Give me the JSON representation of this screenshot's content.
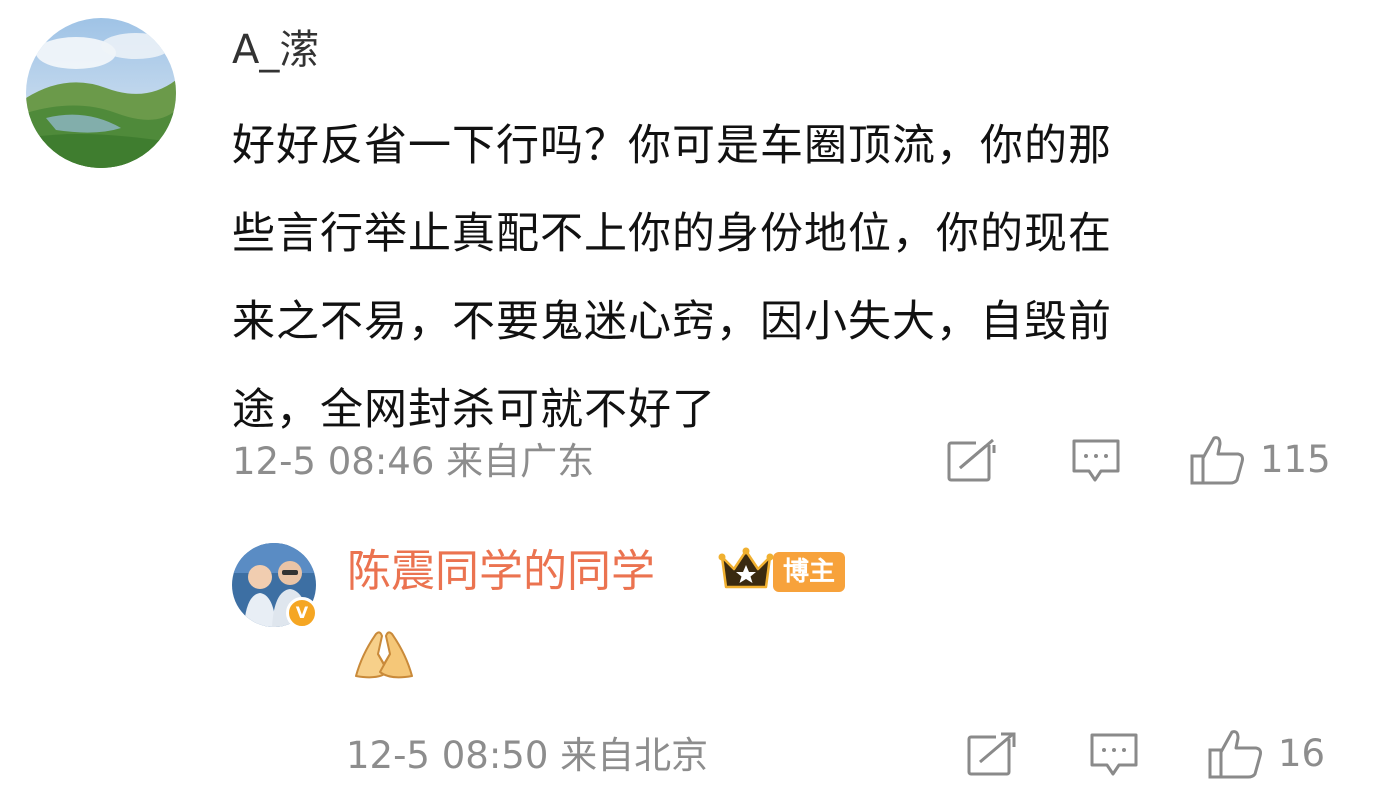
{
  "comments": [
    {
      "username": "A_潆",
      "lines": [
        "好好反省一下行吗？你可是车圈顶流，你的那",
        "些言行举止真配不上你的身份地位，你的现在",
        "来之不易，不要鬼迷心窍，因小失大，自毁前",
        "途，全网封杀可就不好了"
      ],
      "timestamp": "12-5 08:46 来自广东",
      "like_count": "115"
    },
    {
      "username": "陈震同学的同学",
      "badge_label": "博主",
      "verified_mark": "V",
      "reply_content_icon": "folded-hands-emoji",
      "timestamp": "12-5 08:50 来自北京",
      "like_count": "16"
    }
  ],
  "icons": {
    "share": "share-icon",
    "reply": "comment-icon",
    "like": "thumbs-up-icon"
  },
  "colors": {
    "blogger_name": "#eb7350",
    "badge_bg": "#f7a23b",
    "meta_text": "#8d8d8d"
  }
}
